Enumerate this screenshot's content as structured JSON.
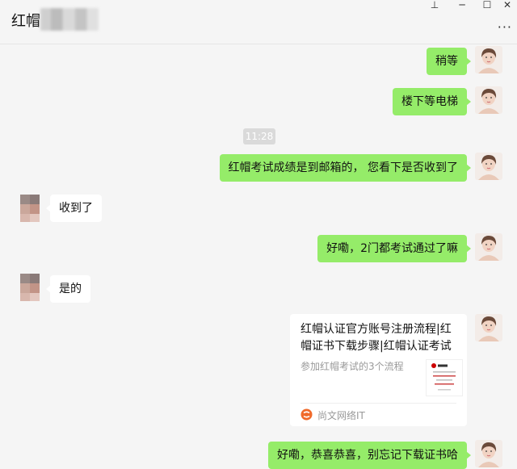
{
  "window": {
    "title": "红帽",
    "controls": {
      "pin": "⊥",
      "minimize": "─",
      "maximize": "☐",
      "close": "✕",
      "more": "···"
    }
  },
  "messages": [
    {
      "side": "self",
      "text": "稍等"
    },
    {
      "side": "self",
      "text": "楼下等电梯"
    },
    {
      "side": "time",
      "text": "11:28"
    },
    {
      "side": "self",
      "text": "红帽考试成绩是到邮箱的，  您看下是否收到了"
    },
    {
      "side": "peer",
      "text": "收到了"
    },
    {
      "side": "self",
      "text": "好嘞，2门都考试通过了嘛"
    },
    {
      "side": "peer",
      "text": "是的"
    },
    {
      "side": "self",
      "text": "好嘞，恭喜恭喜，别忘记下载证书哈"
    }
  ],
  "card": {
    "title": "红帽认证官方账号注册流程|红帽证书下载步骤|红帽认证考试流...",
    "description": "参加红帽考试的3个流程",
    "source": "尚文网络IT"
  },
  "colors": {
    "self_bubble": "#95ec69",
    "peer_bubble": "#ffffff",
    "background": "#f5f5f5"
  }
}
